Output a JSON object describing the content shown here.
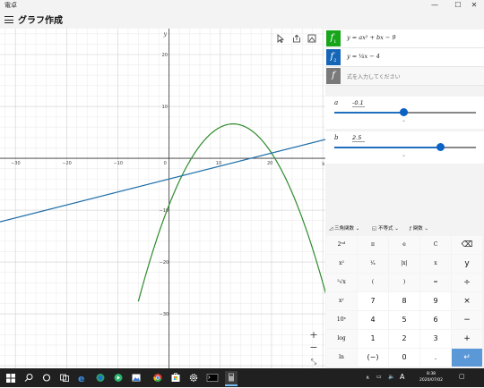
{
  "window": {
    "title": "電卓",
    "mode": "グラフ作成",
    "buttons": {
      "minimize": "—",
      "maximize": "☐",
      "close": "✕"
    }
  },
  "graph": {
    "x_ticks": [
      "−30",
      "−20",
      "−10",
      "0",
      "10",
      "20"
    ],
    "y_ticks": [
      "20",
      "10",
      "−10",
      "−20",
      "−30"
    ],
    "x_axis_label": "x",
    "y_axis_label": "y",
    "zoom_in": "+",
    "zoom_out": "−",
    "fit": "⤡"
  },
  "chart_data": {
    "type": "line",
    "xlim": [
      -33,
      30.5
    ],
    "ylim": [
      -40.5,
      25
    ],
    "grid": true,
    "series": [
      {
        "function": "y = -0.1x^2 + 2.5x - 9",
        "color": "#2e8b2e",
        "x": [
          -4,
          0,
          4,
          8,
          12.5,
          17,
          21,
          25,
          30
        ],
        "y": [
          -20.6,
          -9,
          -1.6,
          4.6,
          6.6,
          4.6,
          -0.6,
          -8.5,
          -24
        ]
      },
      {
        "function": "y = (1/4)x - 4",
        "color": "#1f6fa8",
        "x": [
          -33,
          30.5
        ],
        "y": [
          -12.25,
          3.63
        ]
      }
    ]
  },
  "functions": [
    {
      "badge": "f",
      "sub": "1",
      "color": "#17a51a",
      "expr": "y = ax² + bx − 9"
    },
    {
      "badge": "f",
      "sub": "2",
      "color": "#1666b8",
      "expr": "y = ¼x − 4"
    },
    {
      "badge": "f",
      "sub": "",
      "color": "#7a7a7a",
      "placeholder": "式を入力してください"
    }
  ],
  "sliders": [
    {
      "name": "a",
      "value": "-0.1",
      "position": 0.49
    },
    {
      "name": "b",
      "value": "2.5",
      "position": 0.75
    }
  ],
  "keypad_tabs": [
    {
      "icon": "◿",
      "label": "三角関数 ⌄"
    },
    {
      "icon": "◱",
      "label": "不等式 ⌄"
    },
    {
      "icon": "ƒ",
      "label": "関数 ⌄"
    }
  ],
  "keys": [
    [
      "2ⁿᵈ",
      "π",
      "e",
      "C",
      "⌫"
    ],
    [
      "x²",
      "¹⁄ₓ",
      "|x|",
      "x",
      "y"
    ],
    [
      "²√x",
      "(",
      ")",
      "=",
      "÷"
    ],
    [
      "xʸ",
      "7",
      "8",
      "9",
      "×"
    ],
    [
      "10ˣ",
      "4",
      "5",
      "6",
      "−"
    ],
    [
      "log",
      "1",
      "2",
      "3",
      "+"
    ],
    [
      "ln",
      "(−)",
      "0",
      ".",
      "↵"
    ]
  ],
  "taskbar": {
    "time": "8:38",
    "date": "2020/07/02",
    "ime": "A"
  }
}
